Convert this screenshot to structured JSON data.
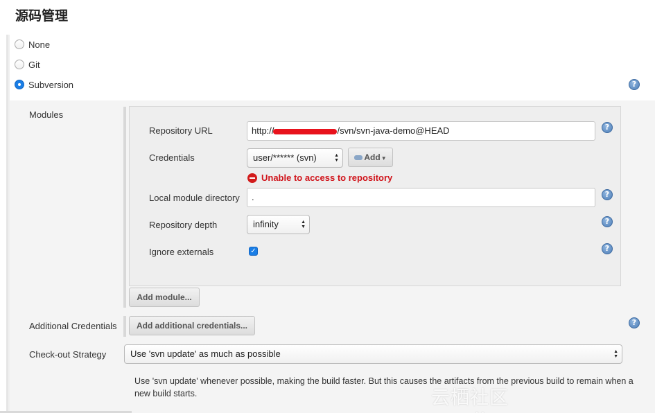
{
  "section_title": "源码管理",
  "scm_options": [
    {
      "label": "None",
      "checked": false
    },
    {
      "label": "Git",
      "checked": false
    },
    {
      "label": "Subversion",
      "checked": true
    }
  ],
  "modules": {
    "label": "Modules",
    "repository_url": {
      "label": "Repository URL",
      "prefix": "http://",
      "suffix": "/svn/svn-java-demo@HEAD"
    },
    "credentials": {
      "label": "Credentials",
      "selected": "user/****** (svn)",
      "add_button": "Add"
    },
    "error": "Unable to access to repository",
    "local_module_directory": {
      "label": "Local module directory",
      "value": "."
    },
    "repository_depth": {
      "label": "Repository depth",
      "selected": "infinity"
    },
    "ignore_externals": {
      "label": "Ignore externals",
      "checked": true
    },
    "add_module_button": "Add module..."
  },
  "additional_credentials": {
    "label": "Additional Credentials",
    "button": "Add additional credentials..."
  },
  "checkout_strategy": {
    "label": "Check-out Strategy",
    "selected": "Use 'svn update' as much as possible",
    "description": "Use 'svn update' whenever possible, making the build faster. But this causes the artifacts from the previous build to remain when a new build starts."
  },
  "help_icon_glyph": "?",
  "watermark": "云栖社区 yq.aliyun.com",
  "colors": {
    "accent": "#1a7ee6",
    "error": "#d0141b",
    "help": "#4f7fb8"
  }
}
